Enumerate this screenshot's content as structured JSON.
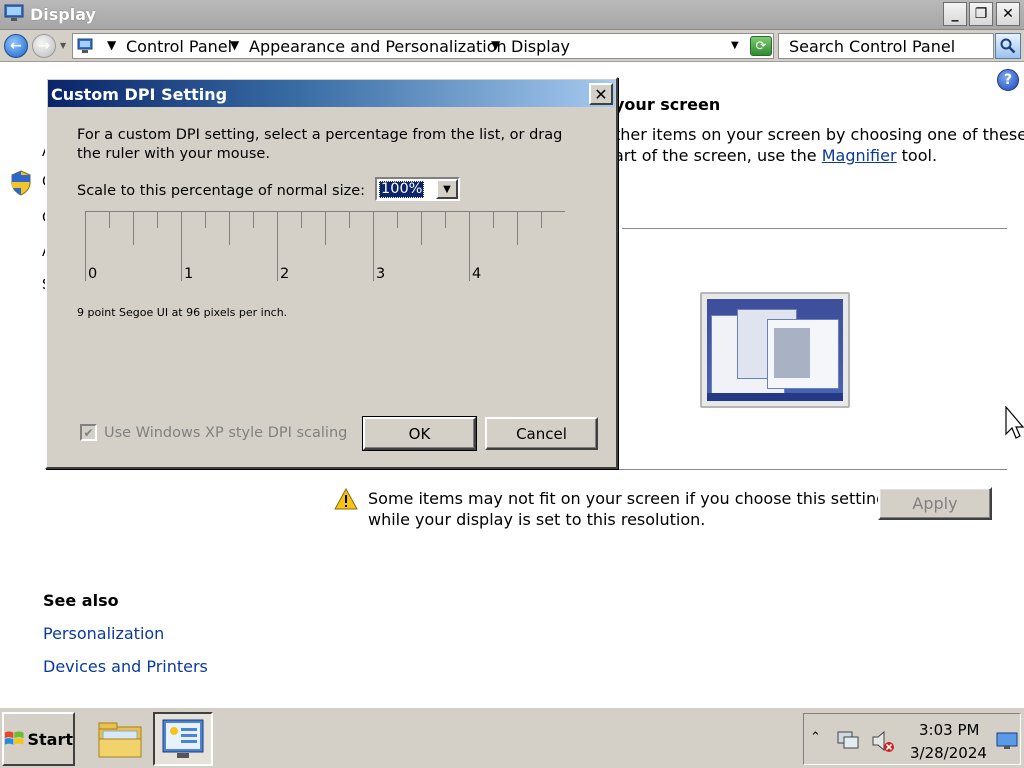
{
  "window": {
    "title": "Display",
    "minimize_glyph": "_",
    "maximize_glyph": "❐",
    "close_glyph": "✕"
  },
  "address_bar": {
    "crumbs": [
      "Control Panel",
      "Appearance and Personalization",
      "Display"
    ],
    "search_placeholder": "Search Control Panel"
  },
  "main": {
    "heading_fragment": "your screen",
    "desc_line1": "ther items on your screen by choosing one of these",
    "desc_line2_pre": "art of the screen, use the ",
    "desc_link": "Magnifier",
    "desc_line2_post": " tool.",
    "warning_line1": "Some items may not fit on your screen if you choose this setting",
    "warning_line2": "while your display is set to this resolution.",
    "apply_label": "Apply",
    "see_also_heading": "See also",
    "see_also_links": [
      "Personalization",
      "Devices and Printers"
    ]
  },
  "dialog": {
    "title": "Custom DPI Setting",
    "desc_line1": "For a custom DPI setting, select a percentage from the list, or drag",
    "desc_line2": "the ruler with your mouse.",
    "scale_label": "Scale to this percentage of normal size:",
    "scale_value": "100%",
    "ruler_numbers": [
      "0",
      "1",
      "2",
      "3",
      "4"
    ],
    "info_text": "9 point Segoe UI at 96 pixels per inch.",
    "xp_scaling_label": "Use Windows XP style DPI scaling",
    "xp_scaling_checked": true,
    "ok_label": "OK",
    "cancel_label": "Cancel"
  },
  "taskbar": {
    "start_label": "Start",
    "time": "3:03 PM",
    "date": "3/28/2024"
  },
  "colors": {
    "dialog_title_start": "#0a246a",
    "dialog_title_end": "#a6caf0",
    "link": "#0a3a9f",
    "face": "#d4d0c8"
  }
}
